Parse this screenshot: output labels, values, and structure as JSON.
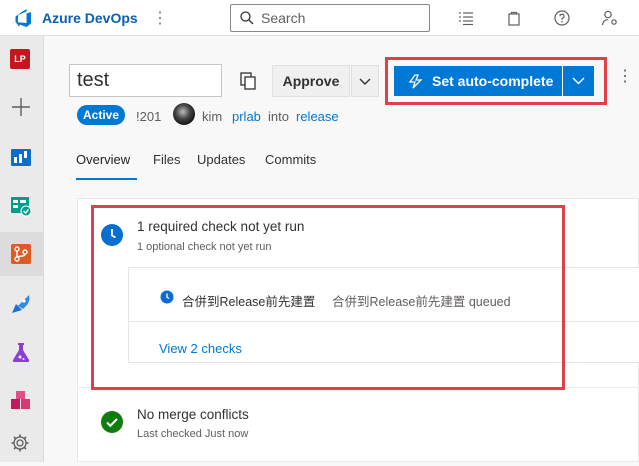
{
  "topbar": {
    "brand": "Azure DevOps",
    "search_placeholder": "Search",
    "icons": [
      "logo-icon",
      "more-vertical-icon",
      "search-icon",
      "list-icon",
      "shopping-bag-icon",
      "help-icon",
      "user-settings-icon"
    ]
  },
  "leftnav": {
    "project_initials": "LP",
    "project_color": "#c4171d",
    "items": [
      "project-avatar",
      "add-icon",
      "boards-icon",
      "test-plans-icon",
      "repos-icon",
      "pipelines-icon",
      "artifacts-icon",
      "package-icon",
      "settings-icon"
    ]
  },
  "pr": {
    "title": "test",
    "approve_label": "Approve",
    "autocomplete_label": "Set auto-complete",
    "status": "Active",
    "id": "!201",
    "author": "kim",
    "source_branch": "prlab",
    "into_text": "into",
    "target_branch": "release"
  },
  "tabs": [
    {
      "label": "Overview",
      "active": true
    },
    {
      "label": "Files",
      "active": false
    },
    {
      "label": "Updates",
      "active": false
    },
    {
      "label": "Commits",
      "active": false
    }
  ],
  "checks": {
    "summary": "1 required check not yet run",
    "optional": "1 optional check not yet run",
    "item_name": "合併到Release前先建置",
    "item_detail": "合併到Release前先建置 queued",
    "view_link": "View 2 checks"
  },
  "merge": {
    "title": "No merge conflicts",
    "subtitle": "Last checked Just now"
  },
  "colors": {
    "accent": "#0078d4",
    "highlight": "#e04048",
    "success": "#107c10"
  }
}
